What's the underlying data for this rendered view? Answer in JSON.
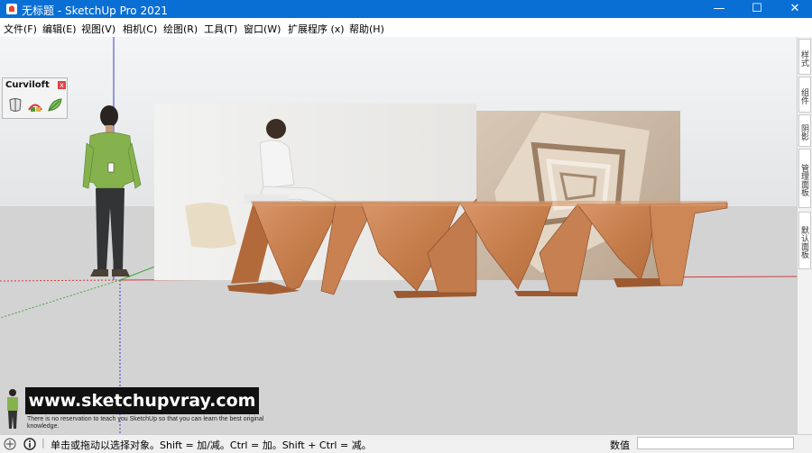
{
  "window": {
    "title": "无标题 - SketchUp Pro 2021",
    "minimize": "—",
    "maximize": "☐",
    "close": "✕"
  },
  "menu": [
    "文件(F)",
    "编辑(E)",
    "视图(V)",
    "相机(C)",
    "绘图(R)",
    "工具(T)",
    "窗口(W)",
    "扩展程序 (x)",
    "帮助(H)"
  ],
  "toolbar": {
    "title": "Curviloft",
    "close": "x",
    "icons": [
      "loft-by-spline-icon",
      "skin-contours-icon",
      "loft-along-path-icon"
    ]
  },
  "tray": {
    "tabs": [
      "样式",
      "组件",
      "阴影",
      "管理面板",
      "默认面板"
    ]
  },
  "watermark": {
    "site": "www.sketchupvray.com",
    "tagline": "There is no reservation to teach you SketchUp so that you can learn the best original knowledge."
  },
  "status": {
    "hint": "单击或拖动以选择对象。Shift = 加/减。Ctrl = 加。Shift + Ctrl = 减。",
    "measure_label": "数值",
    "measure_value": ""
  },
  "colors": {
    "titlebar": "#0a6fd4",
    "wood": "#c9814f",
    "sky": "#e6e8ea",
    "ground": "#d2d2d2"
  }
}
